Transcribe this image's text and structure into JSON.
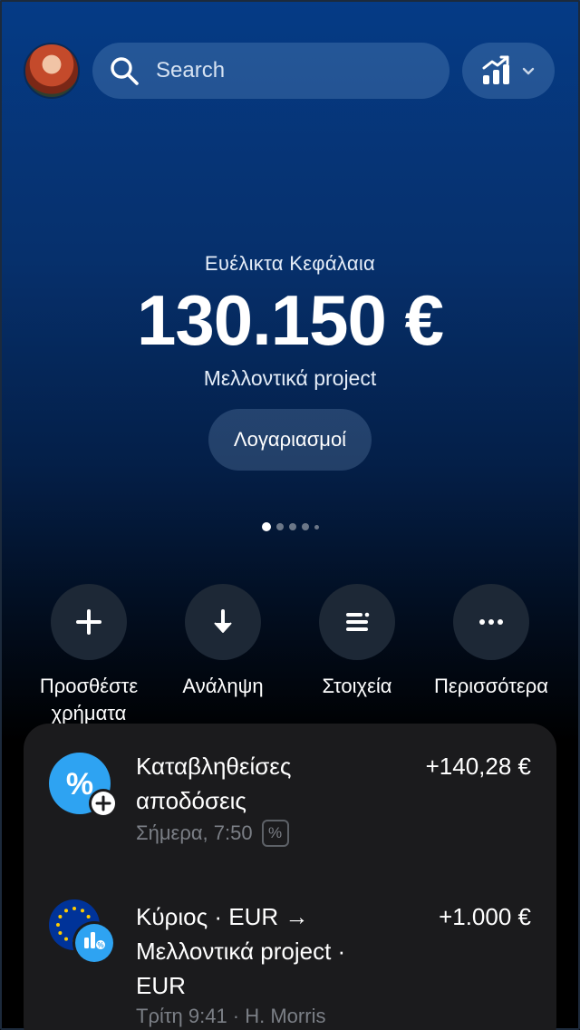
{
  "search": {
    "placeholder": "Search"
  },
  "balance": {
    "label": "Ευέλικτα Κεφάλαια",
    "amount": "130.150 €",
    "subtitle": "Μελλοντικά project",
    "accounts_button": "Λογαριασμοί"
  },
  "pager": {
    "count": 5,
    "active_index": 0
  },
  "actions": [
    {
      "label": "Προσθέστε χρήματα",
      "icon": "plus-icon"
    },
    {
      "label": "Ανάληψη",
      "icon": "arrow-down-icon"
    },
    {
      "label": "Στοιχεία",
      "icon": "details-icon"
    },
    {
      "label": "Περισσότερα",
      "icon": "more-icon"
    }
  ],
  "transactions": [
    {
      "title": "Καταβληθείσες αποδόσεις",
      "amount": "+140,28 €",
      "meta": "Σήμερα, 7:50",
      "meta_badge": "%",
      "icon": "percent-icon"
    },
    {
      "title": "Κύριος · EUR → Μελλοντικά project · EUR",
      "amount": "+1.000 €",
      "meta": "Τρίτη 9:41 · H. Morris",
      "icon": "eu-flag-icon"
    }
  ],
  "colors": {
    "accent": "#2ea3f2",
    "background_top": "#053b86",
    "card": "#1b1b1d"
  }
}
